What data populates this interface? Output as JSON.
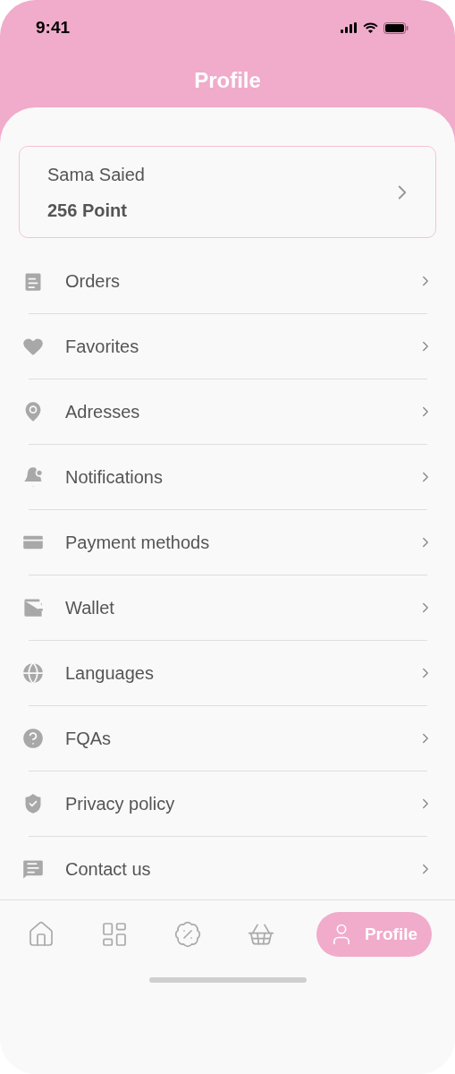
{
  "status_bar": {
    "time": "9:41"
  },
  "header": {
    "title": "Profile"
  },
  "profile_card": {
    "name": "Sama Saied",
    "points": "256 Point"
  },
  "menu": [
    {
      "kind": "orders",
      "label": "Orders"
    },
    {
      "kind": "favorites",
      "label": "Favorites"
    },
    {
      "kind": "addresses",
      "label": "Adresses"
    },
    {
      "kind": "notifications",
      "label": "Notifications"
    },
    {
      "kind": "payment",
      "label": "Payment methods"
    },
    {
      "kind": "wallet",
      "label": "Wallet"
    },
    {
      "kind": "languages",
      "label": "Languages"
    },
    {
      "kind": "faq",
      "label": "FQAs"
    },
    {
      "kind": "privacy",
      "label": "Privacy policy"
    },
    {
      "kind": "contact",
      "label": "Contact us"
    }
  ],
  "bottom_nav": [
    {
      "kind": "home",
      "selected": false
    },
    {
      "kind": "categories",
      "selected": false
    },
    {
      "kind": "offers",
      "selected": false
    },
    {
      "kind": "basket",
      "selected": false
    },
    {
      "kind": "profile",
      "selected": true,
      "label": "Profile"
    }
  ]
}
